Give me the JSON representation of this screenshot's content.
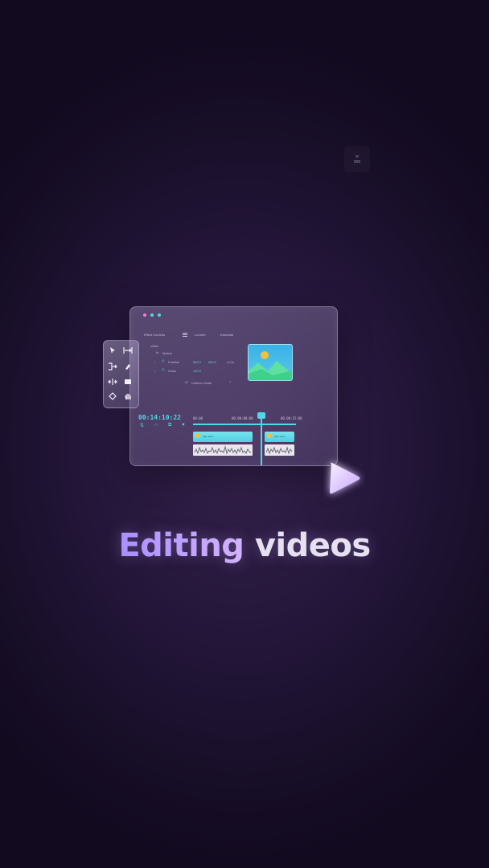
{
  "corner_icon": "tools-icon",
  "editor": {
    "dot_colors": [
      "#ff7ad0",
      "#4fd9e8",
      "#4fd9e8"
    ],
    "tabs": {
      "effect_controls": "Effect Controls",
      "lumetri": "Lumetri",
      "essential": "Essential"
    },
    "properties": {
      "section": "Video",
      "motion": "Motion",
      "position_label": "Position",
      "position_x": "540.0",
      "position_y": "540.0",
      "scale_label": "Scale",
      "scale_value": "100.0",
      "uniform_scale": "Uniform Scale"
    },
    "timeline": {
      "timecode": "00:14:10:22",
      "ruler": [
        "00:00",
        "00:00:00:00",
        "00:00:15:00"
      ],
      "clips": [
        "Clip name",
        "Clip name"
      ]
    },
    "thumbnail_icon": "image-icon"
  },
  "tools": [
    "selection-tool-icon",
    "track-select-icon",
    "ripple-edit-icon",
    "pen-icon",
    "slip-icon",
    "rectangle-icon",
    "razor-icon",
    "hand-icon"
  ],
  "headline": {
    "accent": "Editing",
    "rest": " videos"
  },
  "colors": {
    "accent": "#4fd9e8",
    "headline_gradient_start": "#a58cff",
    "headline_gradient_end": "#d6b6ff",
    "play": "#e8d8ff"
  }
}
